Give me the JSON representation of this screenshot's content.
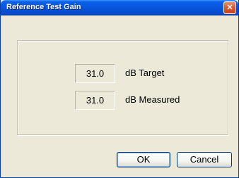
{
  "window": {
    "title": "Reference Test Gain",
    "close_glyph": "✕"
  },
  "fields": [
    {
      "value": "31.0",
      "unit": "dB Target"
    },
    {
      "value": "31.0",
      "unit": "dB Measured"
    }
  ],
  "buttons": {
    "ok_label": "OK",
    "cancel_label": "Cancel"
  },
  "colors": {
    "titlebar": "#0855dd",
    "dialog_background": "#ece9d8",
    "close_button": "#dc5a34"
  }
}
